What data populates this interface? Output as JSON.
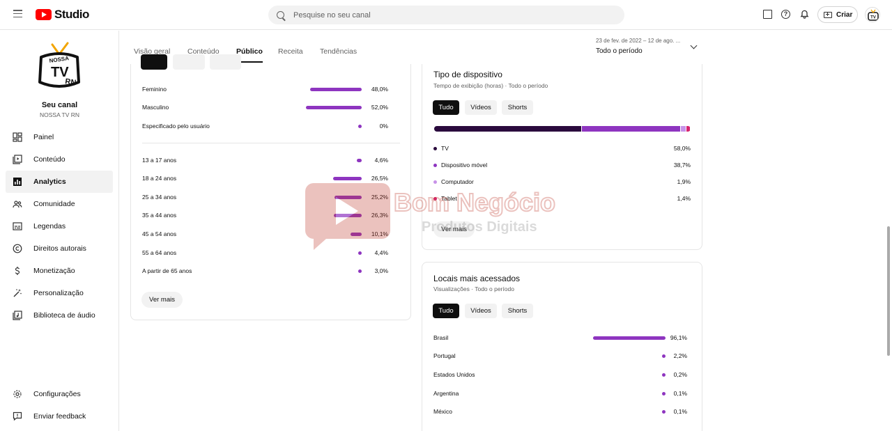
{
  "header": {
    "logo_text": "Studio",
    "search_placeholder": "Pesquise no seu canal",
    "create_label": "Criar"
  },
  "sidebar": {
    "channel_title": "Seu canal",
    "channel_handle": "NOSSA TV RN",
    "channel_logo_text": [
      "NOSSA",
      "TV",
      "RN"
    ],
    "items": [
      {
        "label": "Painel",
        "icon": "dashboard-icon"
      },
      {
        "label": "Conteúdo",
        "icon": "content-icon"
      },
      {
        "label": "Analytics",
        "icon": "analytics-icon",
        "active": true
      },
      {
        "label": "Comunidade",
        "icon": "community-icon"
      },
      {
        "label": "Legendas",
        "icon": "subtitles-icon"
      },
      {
        "label": "Direitos autorais",
        "icon": "copyright-icon"
      },
      {
        "label": "Monetização",
        "icon": "dollar-icon"
      },
      {
        "label": "Personalização",
        "icon": "magic-wand-icon"
      },
      {
        "label": "Biblioteca de áudio",
        "icon": "audio-library-icon"
      }
    ],
    "bottom_items": [
      {
        "label": "Configurações",
        "icon": "gear-icon"
      },
      {
        "label": "Enviar feedback",
        "icon": "feedback-icon"
      }
    ]
  },
  "tabs": [
    {
      "label": "Visão geral"
    },
    {
      "label": "Conteúdo"
    },
    {
      "label": "Público",
      "active": true
    },
    {
      "label": "Receita"
    },
    {
      "label": "Tendências"
    }
  ],
  "period": {
    "range": "23 de fev. de 2022 – 12 de ago. ...",
    "label": "Todo o período"
  },
  "demographics": {
    "gender": [
      {
        "label": "Feminino",
        "value": "48,0%",
        "pct": 48.0
      },
      {
        "label": "Masculino",
        "value": "52,0%",
        "pct": 52.0
      },
      {
        "label": "Especificado pelo usuário",
        "value": "0%",
        "pct": 0
      }
    ],
    "age": [
      {
        "label": "13 a 17 anos",
        "value": "4,6%",
        "pct": 4.6
      },
      {
        "label": "18 a 24 anos",
        "value": "26,5%",
        "pct": 26.5
      },
      {
        "label": "25 a 34 anos",
        "value": "25,2%",
        "pct": 25.2
      },
      {
        "label": "35 a 44 anos",
        "value": "26,3%",
        "pct": 26.3
      },
      {
        "label": "45 a 54 anos",
        "value": "10,1%",
        "pct": 10.1
      },
      {
        "label": "55 a 64 anos",
        "value": "4,4%",
        "pct": 4.4
      },
      {
        "label": "A partir de 65 anos",
        "value": "3,0%",
        "pct": 3.0
      }
    ],
    "more_label": "Ver mais"
  },
  "device": {
    "title": "Tipo de dispositivo",
    "subtitle": "Tempo de exibição (horas) · Todo o período",
    "chips": [
      "Tudo",
      "Vídeos",
      "Shorts"
    ],
    "items": [
      {
        "label": "TV",
        "value": "58,0%",
        "pct": 58.0,
        "color": "#2a0a3d"
      },
      {
        "label": "Dispositivo móvel",
        "value": "38,7%",
        "pct": 38.7,
        "color": "#8e35c0"
      },
      {
        "label": "Computador",
        "value": "1,9%",
        "pct": 1.9,
        "color": "#c792e8"
      },
      {
        "label": "Tablet",
        "value": "1,4%",
        "pct": 1.4,
        "color": "#d6246e"
      }
    ],
    "more_label": "Ver mais"
  },
  "locations": {
    "title": "Locais mais acessados",
    "subtitle": "Visualizações · Todo o período",
    "chips": [
      "Tudo",
      "Vídeos",
      "Shorts"
    ],
    "items": [
      {
        "label": "Brasil",
        "value": "96,1%",
        "pct": 96.1
      },
      {
        "label": "Portugal",
        "value": "2,2%",
        "pct": 2.2
      },
      {
        "label": "Estados Unidos",
        "value": "0,2%",
        "pct": 0.2
      },
      {
        "label": "Argentina",
        "value": "0,1%",
        "pct": 0.1
      },
      {
        "label": "México",
        "value": "0,1%",
        "pct": 0.1
      }
    ]
  },
  "watermark": {
    "line1": "Bom Negócio",
    "line2": "Produtos Digitais"
  },
  "colors": {
    "accent": "#8e35c0"
  }
}
